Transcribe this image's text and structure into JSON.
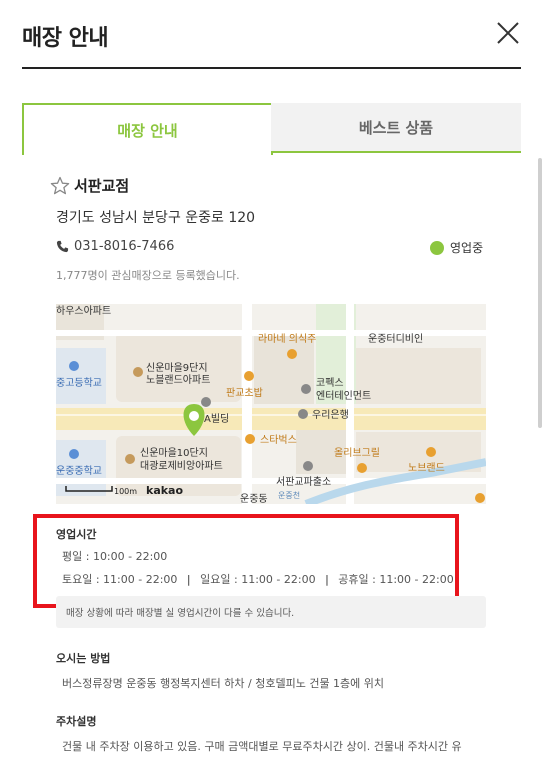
{
  "header": {
    "title": "매장 안내",
    "close_icon": "close-icon"
  },
  "tabs": [
    {
      "label": "매장 안내",
      "active": true
    },
    {
      "label": "베스트 상품",
      "active": false
    }
  ],
  "colors": {
    "accent": "#8cc63f",
    "highlight_box": "#e8141c"
  },
  "store": {
    "name": "서판교점",
    "address": "경기도 성남시 분당구 운중로 120",
    "phone": "031-8016-7466",
    "status": "영업중",
    "favorites": "1,777명이 관심매장으로 등록했습니다."
  },
  "map": {
    "labels": {
      "l1": "하우스아파트",
      "l2": "라마네 의식주",
      "l3": "운중터디비인",
      "l4": "신운마을9단지",
      "l5": "노블랜드아파트",
      "l6": "판교초밥",
      "l7": "코펙스",
      "l8": "엔터테인먼트",
      "l9": "중고등학교",
      "l10": "A빌딩",
      "l11": "우리은행",
      "l12": "스타벅스",
      "l13": "올리브그릴",
      "l14": "신운마을10단지",
      "l15": "대광로제비앙아파트",
      "l16": "노브랜드",
      "l17": "운중중학교",
      "l18": "서판교파출소",
      "l19": "운중동",
      "l20": "운중천"
    },
    "scale": "100m",
    "brand": "kakao"
  },
  "hours": {
    "title": "영업시간",
    "weekday": "평일 : 10:00 - 22:00",
    "saturday": "토요일 : 11:00 - 22:00",
    "sunday": "일요일 : 11:00 - 22:00",
    "holiday": "공휴일 : 11:00 - 22:00",
    "separator": "|"
  },
  "notice": "매장 상황에 따라 매장별 실 영업시간이 다를 수 있습니다.",
  "directions": {
    "title": "오시는 방법",
    "body": "버스정류장명 운중동 행정복지센터 하차 / 청호델피노 건물 1층에 위치"
  },
  "parking": {
    "title": "주차설명",
    "body": "건물 내 주차장 이용하고 있음. 구매 금액대별로 무료주차시간 상이. 건물내 주차시간 유"
  }
}
